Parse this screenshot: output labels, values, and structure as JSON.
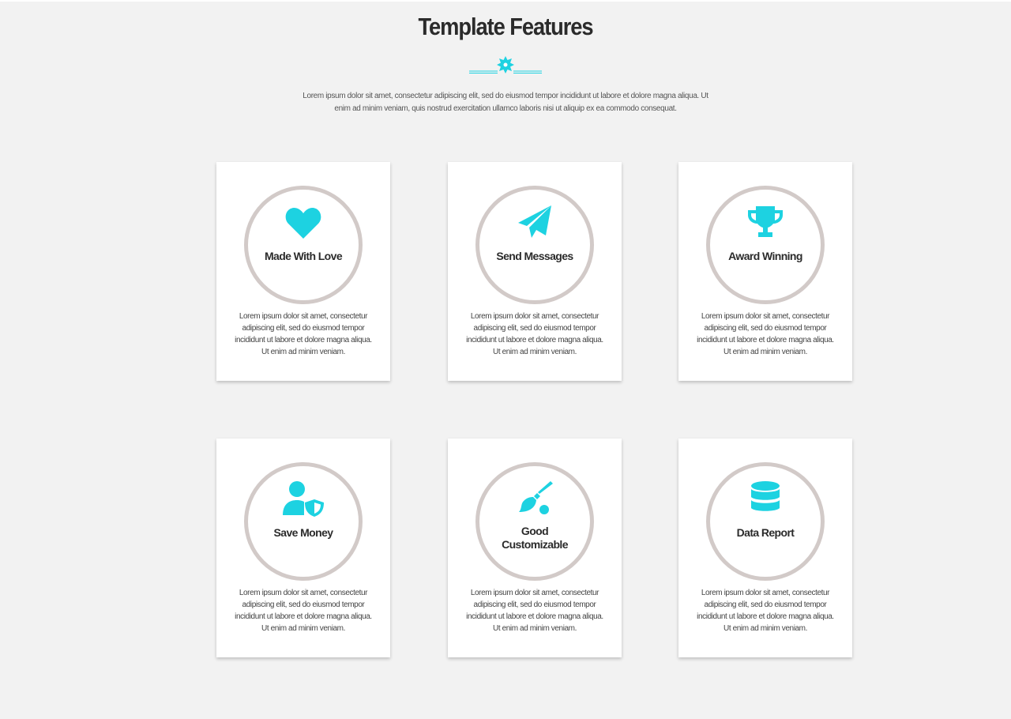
{
  "header": {
    "title": "Template Features",
    "intro": "Lorem ipsum dolor sit amet, consectetur adipiscing elit, sed do eiusmod tempor incididunt ut labore et dolore magna aliqua. Ut enim ad minim veniam, quis nostrud exercitation ullamco laboris nisi ut aliquip ex ea commodo consequat."
  },
  "colors": {
    "accent": "#1dd2e1",
    "ring": "#d2cac8",
    "background": "#f2f2f2"
  },
  "features": [
    {
      "title": "Made With Love",
      "icon": "heart-icon",
      "text": "Lorem ipsum dolor sit amet, consectetur adipiscing elit, sed do eiusmod tempor incididunt ut labore et dolore magna aliqua. Ut enim ad minim veniam."
    },
    {
      "title": "Send Messages",
      "icon": "paper-plane-icon",
      "text": "Lorem ipsum dolor sit amet, consectetur adipiscing elit, sed do eiusmod tempor incididunt ut labore et dolore magna aliqua. Ut enim ad minim veniam."
    },
    {
      "title": "Award Winning",
      "icon": "trophy-icon",
      "text": "Lorem ipsum dolor sit amet, consectetur adipiscing elit, sed do eiusmod tempor incididunt ut labore et dolore magna aliqua. Ut enim ad minim veniam."
    },
    {
      "title": "Save Money",
      "icon": "user-shield-icon",
      "text": "Lorem ipsum dolor sit amet, consectetur adipiscing elit, sed do eiusmod tempor incididunt ut labore et dolore magna aliqua. Ut enim ad minim veniam."
    },
    {
      "title_line1": "Good",
      "title_line2": "Customizable",
      "icon": "paint-brush-icon",
      "text": "Lorem ipsum dolor sit amet, consectetur adipiscing elit, sed do eiusmod tempor incididunt ut labore et dolore magna aliqua. Ut enim ad minim veniam."
    },
    {
      "title": "Data Report",
      "icon": "database-icon",
      "text": "Lorem ipsum dolor sit amet, consectetur adipiscing elit, sed do eiusmod tempor incididunt ut labore et dolore magna aliqua. Ut enim ad minim veniam."
    }
  ]
}
